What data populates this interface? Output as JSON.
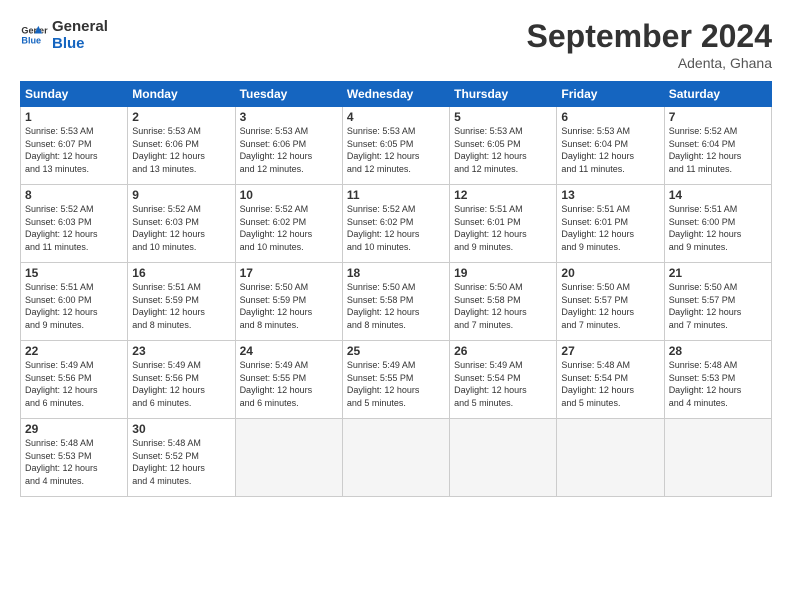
{
  "logo": {
    "text_general": "General",
    "text_blue": "Blue"
  },
  "header": {
    "month_year": "September 2024",
    "location": "Adenta, Ghana"
  },
  "weekdays": [
    "Sunday",
    "Monday",
    "Tuesday",
    "Wednesday",
    "Thursday",
    "Friday",
    "Saturday"
  ],
  "weeks": [
    [
      {
        "day": "1",
        "lines": [
          "Sunrise: 5:53 AM",
          "Sunset: 6:07 PM",
          "Daylight: 12 hours",
          "and 13 minutes."
        ]
      },
      {
        "day": "2",
        "lines": [
          "Sunrise: 5:53 AM",
          "Sunset: 6:06 PM",
          "Daylight: 12 hours",
          "and 13 minutes."
        ]
      },
      {
        "day": "3",
        "lines": [
          "Sunrise: 5:53 AM",
          "Sunset: 6:06 PM",
          "Daylight: 12 hours",
          "and 12 minutes."
        ]
      },
      {
        "day": "4",
        "lines": [
          "Sunrise: 5:53 AM",
          "Sunset: 6:05 PM",
          "Daylight: 12 hours",
          "and 12 minutes."
        ]
      },
      {
        "day": "5",
        "lines": [
          "Sunrise: 5:53 AM",
          "Sunset: 6:05 PM",
          "Daylight: 12 hours",
          "and 12 minutes."
        ]
      },
      {
        "day": "6",
        "lines": [
          "Sunrise: 5:53 AM",
          "Sunset: 6:04 PM",
          "Daylight: 12 hours",
          "and 11 minutes."
        ]
      },
      {
        "day": "7",
        "lines": [
          "Sunrise: 5:52 AM",
          "Sunset: 6:04 PM",
          "Daylight: 12 hours",
          "and 11 minutes."
        ]
      }
    ],
    [
      {
        "day": "8",
        "lines": [
          "Sunrise: 5:52 AM",
          "Sunset: 6:03 PM",
          "Daylight: 12 hours",
          "and 11 minutes."
        ]
      },
      {
        "day": "9",
        "lines": [
          "Sunrise: 5:52 AM",
          "Sunset: 6:03 PM",
          "Daylight: 12 hours",
          "and 10 minutes."
        ]
      },
      {
        "day": "10",
        "lines": [
          "Sunrise: 5:52 AM",
          "Sunset: 6:02 PM",
          "Daylight: 12 hours",
          "and 10 minutes."
        ]
      },
      {
        "day": "11",
        "lines": [
          "Sunrise: 5:52 AM",
          "Sunset: 6:02 PM",
          "Daylight: 12 hours",
          "and 10 minutes."
        ]
      },
      {
        "day": "12",
        "lines": [
          "Sunrise: 5:51 AM",
          "Sunset: 6:01 PM",
          "Daylight: 12 hours",
          "and 9 minutes."
        ]
      },
      {
        "day": "13",
        "lines": [
          "Sunrise: 5:51 AM",
          "Sunset: 6:01 PM",
          "Daylight: 12 hours",
          "and 9 minutes."
        ]
      },
      {
        "day": "14",
        "lines": [
          "Sunrise: 5:51 AM",
          "Sunset: 6:00 PM",
          "Daylight: 12 hours",
          "and 9 minutes."
        ]
      }
    ],
    [
      {
        "day": "15",
        "lines": [
          "Sunrise: 5:51 AM",
          "Sunset: 6:00 PM",
          "Daylight: 12 hours",
          "and 9 minutes."
        ]
      },
      {
        "day": "16",
        "lines": [
          "Sunrise: 5:51 AM",
          "Sunset: 5:59 PM",
          "Daylight: 12 hours",
          "and 8 minutes."
        ]
      },
      {
        "day": "17",
        "lines": [
          "Sunrise: 5:50 AM",
          "Sunset: 5:59 PM",
          "Daylight: 12 hours",
          "and 8 minutes."
        ]
      },
      {
        "day": "18",
        "lines": [
          "Sunrise: 5:50 AM",
          "Sunset: 5:58 PM",
          "Daylight: 12 hours",
          "and 8 minutes."
        ]
      },
      {
        "day": "19",
        "lines": [
          "Sunrise: 5:50 AM",
          "Sunset: 5:58 PM",
          "Daylight: 12 hours",
          "and 7 minutes."
        ]
      },
      {
        "day": "20",
        "lines": [
          "Sunrise: 5:50 AM",
          "Sunset: 5:57 PM",
          "Daylight: 12 hours",
          "and 7 minutes."
        ]
      },
      {
        "day": "21",
        "lines": [
          "Sunrise: 5:50 AM",
          "Sunset: 5:57 PM",
          "Daylight: 12 hours",
          "and 7 minutes."
        ]
      }
    ],
    [
      {
        "day": "22",
        "lines": [
          "Sunrise: 5:49 AM",
          "Sunset: 5:56 PM",
          "Daylight: 12 hours",
          "and 6 minutes."
        ]
      },
      {
        "day": "23",
        "lines": [
          "Sunrise: 5:49 AM",
          "Sunset: 5:56 PM",
          "Daylight: 12 hours",
          "and 6 minutes."
        ]
      },
      {
        "day": "24",
        "lines": [
          "Sunrise: 5:49 AM",
          "Sunset: 5:55 PM",
          "Daylight: 12 hours",
          "and 6 minutes."
        ]
      },
      {
        "day": "25",
        "lines": [
          "Sunrise: 5:49 AM",
          "Sunset: 5:55 PM",
          "Daylight: 12 hours",
          "and 5 minutes."
        ]
      },
      {
        "day": "26",
        "lines": [
          "Sunrise: 5:49 AM",
          "Sunset: 5:54 PM",
          "Daylight: 12 hours",
          "and 5 minutes."
        ]
      },
      {
        "day": "27",
        "lines": [
          "Sunrise: 5:48 AM",
          "Sunset: 5:54 PM",
          "Daylight: 12 hours",
          "and 5 minutes."
        ]
      },
      {
        "day": "28",
        "lines": [
          "Sunrise: 5:48 AM",
          "Sunset: 5:53 PM",
          "Daylight: 12 hours",
          "and 4 minutes."
        ]
      }
    ],
    [
      {
        "day": "29",
        "lines": [
          "Sunrise: 5:48 AM",
          "Sunset: 5:53 PM",
          "Daylight: 12 hours",
          "and 4 minutes."
        ]
      },
      {
        "day": "30",
        "lines": [
          "Sunrise: 5:48 AM",
          "Sunset: 5:52 PM",
          "Daylight: 12 hours",
          "and 4 minutes."
        ]
      },
      null,
      null,
      null,
      null,
      null
    ]
  ]
}
